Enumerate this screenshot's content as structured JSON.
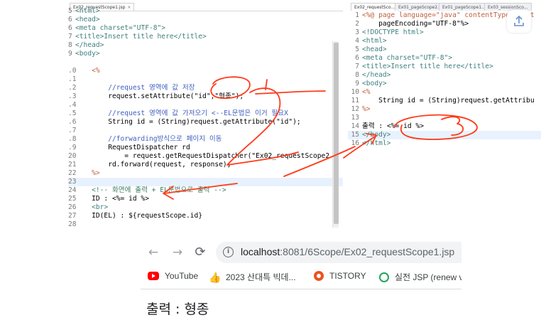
{
  "left_editor": {
    "tabs": [
      {
        "label": "Ex02_requestScope1.jsp",
        "close": "×"
      },
      {
        "label": "Ex02_requestSco...",
        "close": ""
      }
    ],
    "lines": [
      {
        "n": "5",
        "code": "<html>"
      },
      {
        "n": "6",
        "code": "<head>"
      },
      {
        "n": "6",
        "code": "<meta charset=\"UTF-8\">"
      },
      {
        "n": "7",
        "code": "<title>Insert title here</title>"
      },
      {
        "n": "8",
        "code": "</head>"
      },
      {
        "n": "9",
        "code": "<body>"
      },
      {
        "n": "",
        "code": ""
      },
      {
        "n": ".0",
        "code": "    <%"
      },
      {
        "n": ".1",
        "code": ""
      },
      {
        "n": ".2",
        "code": "        //request 영역에 값 저장"
      },
      {
        "n": ".3",
        "code": "        request.setAttribute(\"id\",\"형종\");"
      },
      {
        "n": ".4",
        "code": ""
      },
      {
        "n": ".5",
        "code": "        //request 영역에 값 가져오기 <--EL문법은 이거 필요X"
      },
      {
        "n": ".6",
        "code": "        String id = (String)request.getAttribute(\"id\");"
      },
      {
        "n": ".7",
        "code": ""
      },
      {
        "n": ".8",
        "code": "        //forwarding방식으로 페이지 이동"
      },
      {
        "n": ".9",
        "code": "        RequestDispatcher rd"
      },
      {
        "n": "20",
        "code": "            = request.getRequestDispatcher(\"Ex02_requestScope2"
      },
      {
        "n": "21",
        "code": "        rd.forward(request, response);"
      },
      {
        "n": "22",
        "code": "    %>"
      },
      {
        "n": "23",
        "code": ""
      },
      {
        "n": "24",
        "code": "    <!-- 화면에 출력 + EL문법으로 출력 -->"
      },
      {
        "n": "25",
        "code": "    ID : <%= id %>"
      },
      {
        "n": "26",
        "code": "    <br>"
      },
      {
        "n": "27",
        "code": "    ID(EL) : ${requestScope.id}"
      },
      {
        "n": "28",
        "code": ""
      }
    ]
  },
  "right_editor": {
    "tabs": [
      "Ex02_requestSco...",
      "Ex01_pageScope2...",
      "Ex01_pageScope1...",
      "Ex03_sessionSco..."
    ],
    "lines": [
      {
        "n": "1",
        "m": "",
        "code": "<%@ page language=\"java\" contentType=\"text"
      },
      {
        "n": "2",
        "m": "",
        "code": "    pageEncoding=\"UTF-8\"%>"
      },
      {
        "n": "3",
        "m": "",
        "code": "<!DOCTYPE html>"
      },
      {
        "n": "4",
        "m": "",
        "code": "<html>"
      },
      {
        "n": "5",
        "m": "",
        "code": "<head>"
      },
      {
        "n": "6",
        "m": "",
        "code": "<meta charset=\"UTF-8\">"
      },
      {
        "n": "7",
        "m": "",
        "code": "<title>Insert title here</title>"
      },
      {
        "n": "8",
        "m": "",
        "code": "</head>"
      },
      {
        "n": "9",
        "m": "",
        "code": "<body>"
      },
      {
        "n": "10",
        "m": "",
        "code": "<%"
      },
      {
        "n": "11",
        "m": "",
        "code": "    String id = (String)request.getAttribu"
      },
      {
        "n": "12",
        "m": "",
        "code": "%>"
      },
      {
        "n": "13",
        "m": "",
        "code": ""
      },
      {
        "n": "14",
        "m": "",
        "code": "출력 : <%= id %>"
      },
      {
        "n": "15",
        "m": "",
        "code": "</body>"
      },
      {
        "n": "16",
        "m": "",
        "code": "</html>"
      }
    ]
  },
  "browser": {
    "url_host": "localhost",
    "url_path": ":8081/6Scope/Ex02_requestScope1.jsp",
    "bookmarks": [
      "YouTube",
      "2023 산대특 빅데...",
      "TISTORY",
      "실전 JSP (renew ve"
    ],
    "output": "출력 : 형종"
  },
  "annotations": {
    "numbers": [
      "1",
      "2",
      "3"
    ],
    "color": "#ff3a1a"
  }
}
